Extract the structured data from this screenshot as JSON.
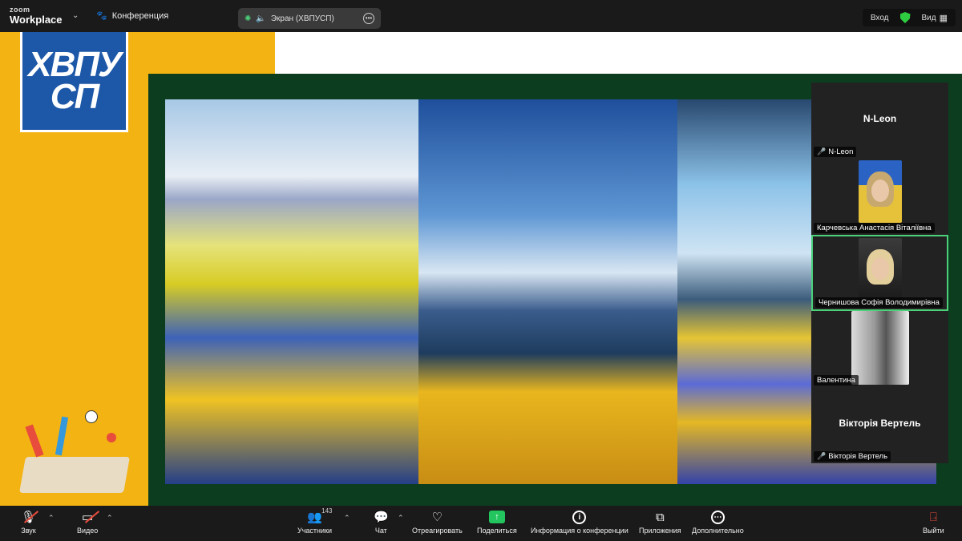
{
  "app": {
    "brand_top": "zoom",
    "brand_bottom": "Workplace",
    "meeting_label": "Конференция"
  },
  "screen_share": {
    "label": "Экран (ХВПУСП)"
  },
  "top_right": {
    "enter_label": "Вход",
    "view_label": "Вид"
  },
  "slide": {
    "logo_line1": "ХВПУ",
    "logo_line2": "СП"
  },
  "participants": [
    {
      "display_name": "N-Leon",
      "label": "N-Leon",
      "muted": true,
      "video": false
    },
    {
      "label": "Карчевська Анастасія Віталіївна",
      "video": true
    },
    {
      "label": "Чернишова Софія Володимирівна",
      "video": true,
      "active_speaker": true
    },
    {
      "label": "Валентина",
      "video": true
    },
    {
      "display_name": "Вікторія Вертель",
      "label": "Вікторія Вертель",
      "muted": true,
      "video": false
    }
  ],
  "toolbar": {
    "audio": "Звук",
    "video": "Видео",
    "participants": "Участники",
    "participants_count": "143",
    "chat": "Чат",
    "react": "Отреагировать",
    "share": "Поделиться",
    "info": "Информация о конференции",
    "apps": "Приложения",
    "more": "Дополнительно",
    "leave": "Выйти"
  },
  "colors": {
    "slide_yellow": "#f3b313",
    "slide_green": "#0b3d1e",
    "logo_blue": "#1d57a8",
    "share_green": "#22c55e",
    "active_border": "#4cd07a"
  }
}
